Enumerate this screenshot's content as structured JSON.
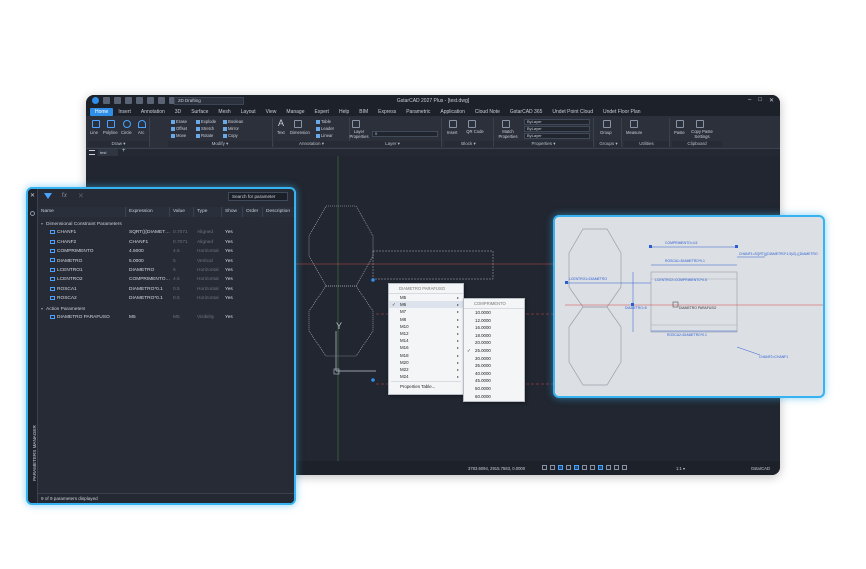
{
  "app": {
    "title": "GstarCAD 2027 Plus - [test.dwg]",
    "workspace": "2D Drafting"
  },
  "menu": [
    "Home",
    "Insert",
    "Annotation",
    "3D",
    "Surface",
    "Mesh",
    "Layout",
    "View",
    "Manage",
    "Expert",
    "Help",
    "BIM",
    "Express",
    "Parametric",
    "Application",
    "Cloud Note",
    "GstarCAD 365",
    "Undet Point Cloud",
    "Undet Floor Plan"
  ],
  "ribbon": {
    "draw": {
      "label": "Draw ▾",
      "tools": [
        "Line",
        "Polyline",
        "Circle",
        "Arc"
      ]
    },
    "modify": {
      "label": "Modify ▾",
      "tools": [
        "Erase",
        "Explode",
        "Boolean",
        "Offset",
        "Stretch",
        "Mirror",
        "Move",
        "Rotate",
        "Copy"
      ]
    },
    "annotation": {
      "label": "Annotation ▾",
      "tools": [
        "Text",
        "Dimension",
        "Table",
        "Leader",
        "Linear"
      ]
    },
    "layer": {
      "label": "Layer ▾",
      "tools": [
        "Layer Properties"
      ],
      "current": "0"
    },
    "block": {
      "label": "Block ▾",
      "tools": [
        "Insert",
        "QR Code"
      ]
    },
    "properties": {
      "label": "Properties ▾",
      "tools": [
        "Match Properties"
      ],
      "combos": [
        "ByLayer",
        "ByLayer",
        "ByLayer"
      ]
    },
    "groups": {
      "label": "Groups ▾",
      "tools": [
        "Group"
      ]
    },
    "utilities": {
      "label": "Utilities",
      "tools": [
        "Measure"
      ]
    },
    "clipboard": {
      "label": "Clipboard",
      "tools": [
        "Paste",
        "Copy Paste Settings"
      ]
    }
  },
  "doc_tab": "test",
  "context_menu": {
    "header": "DIAMETRO PARAFUSO",
    "items": [
      "M5",
      "M6",
      "M7",
      "M8",
      "M10",
      "M12",
      "M14",
      "M16",
      "M18",
      "M20",
      "M22",
      "M24"
    ],
    "checked": "M6",
    "footer": "Properties Table..."
  },
  "sub_menu": {
    "header": "COMPRIMENTO",
    "items": [
      "10.0000",
      "12.0000",
      "16.0000",
      "18.0000",
      "20.0000",
      "25.0000",
      "30.0000",
      "35.0000",
      "40.0000",
      "45.0000",
      "50.0000",
      "60.0000"
    ],
    "checked": "25.0000"
  },
  "status": {
    "coords": "3783.6094, 2915.7583, 0.0000",
    "scale": "1:1 ▾",
    "brand": "GstarCAD"
  },
  "params_panel": {
    "vertical_title": "PARAMETERS MANAGER",
    "search_placeholder": "Search for parameter",
    "columns": [
      "Name",
      "Expression",
      "Value",
      "Type",
      "Show",
      "Order",
      "Description"
    ],
    "group1": "Dimensional Constraint Parameters",
    "rows": [
      {
        "name": "CHANF1",
        "expr": "SQRT(((DIAMET…",
        "value": "0.7071",
        "type": "Aligned",
        "show": "Yes"
      },
      {
        "name": "CHANF2",
        "expr": "CHANF1",
        "value": "0.7071",
        "type": "Aligned",
        "show": "Yes"
      },
      {
        "name": "COMPRIMENTO",
        "expr": "4.5000",
        "value": "4.5",
        "type": "Horizontal",
        "show": "Yes"
      },
      {
        "name": "DIAMETRO",
        "expr": "5.0000",
        "value": "5",
        "type": "Vertical",
        "show": "Yes"
      },
      {
        "name": "LCENTRO1",
        "expr": "DIAMETRO",
        "value": "5",
        "type": "Horizontal",
        "show": "Yes"
      },
      {
        "name": "LCENTRO2",
        "expr": "COMPRIMENTO…",
        "value": "4.5",
        "type": "Horizontal",
        "show": "Yes"
      },
      {
        "name": "ROSCA1",
        "expr": "DIAMETRO*0.1",
        "value": "0.5",
        "type": "Horizontal",
        "show": "Yes"
      },
      {
        "name": "ROSCA2",
        "expr": "DIAMETRO*0.1",
        "value": "0.5",
        "type": "Horizontal",
        "show": "Yes"
      }
    ],
    "group2": "Action Parameters",
    "action_rows": [
      {
        "name": "DIAMETRO PARAFUSO",
        "expr": "M5",
        "value": "M5",
        "type": "Visibility",
        "show": "Yes"
      }
    ],
    "footer": "9 of 9 parameters displayed"
  },
  "inset_labels": {
    "comprimento": "COMPRIMENTO=4.5",
    "chanf1": "CHANF1=SQRT(((DIAMETRO*1.5)/2)-((DIAMETRO",
    "rosca1": "ROSCA1=DIAMETRO*0.1",
    "lcentro1": "LCENTRO1=DIAMETRO",
    "lcentro2": "LCENTRO2=COMPRIMENTO*0.5",
    "diametro": "DIAMETRO=5",
    "parafuso": "DIAMETRO PARAFUSO",
    "rosca2": "ROSCA2=DIAMETRO*0.1",
    "chanf2": "CHANF2=CHANF1"
  }
}
